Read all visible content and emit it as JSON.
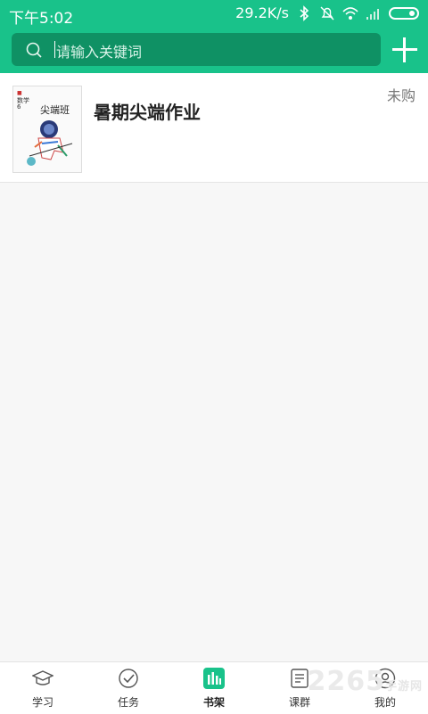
{
  "status_bar": {
    "time": "下午5:02",
    "net_speed": "29.2K/s",
    "icons": [
      "bluetooth-icon",
      "bell-muted-icon",
      "wifi-icon",
      "signal-icon",
      "battery-icon"
    ]
  },
  "search": {
    "placeholder": "请输入关键词"
  },
  "header": {
    "add_icon": "plus-icon",
    "color": "#19c28a"
  },
  "book": {
    "title": "暑期尖端作业",
    "status": "未购",
    "cover": {
      "title": "尖端班",
      "subject": "数学",
      "grade": "6"
    }
  },
  "tabs": [
    {
      "label": "学习",
      "icon": "graduation-cap-icon",
      "active": false
    },
    {
      "label": "任务",
      "icon": "check-circle-icon",
      "active": false
    },
    {
      "label": "书架",
      "icon": "bookshelf-icon",
      "active": true
    },
    {
      "label": "课群",
      "icon": "document-icon",
      "active": false
    },
    {
      "label": "我的",
      "icon": "user-icon",
      "active": false
    }
  ],
  "watermark": {
    "text": "2265",
    "small": "手游网"
  }
}
